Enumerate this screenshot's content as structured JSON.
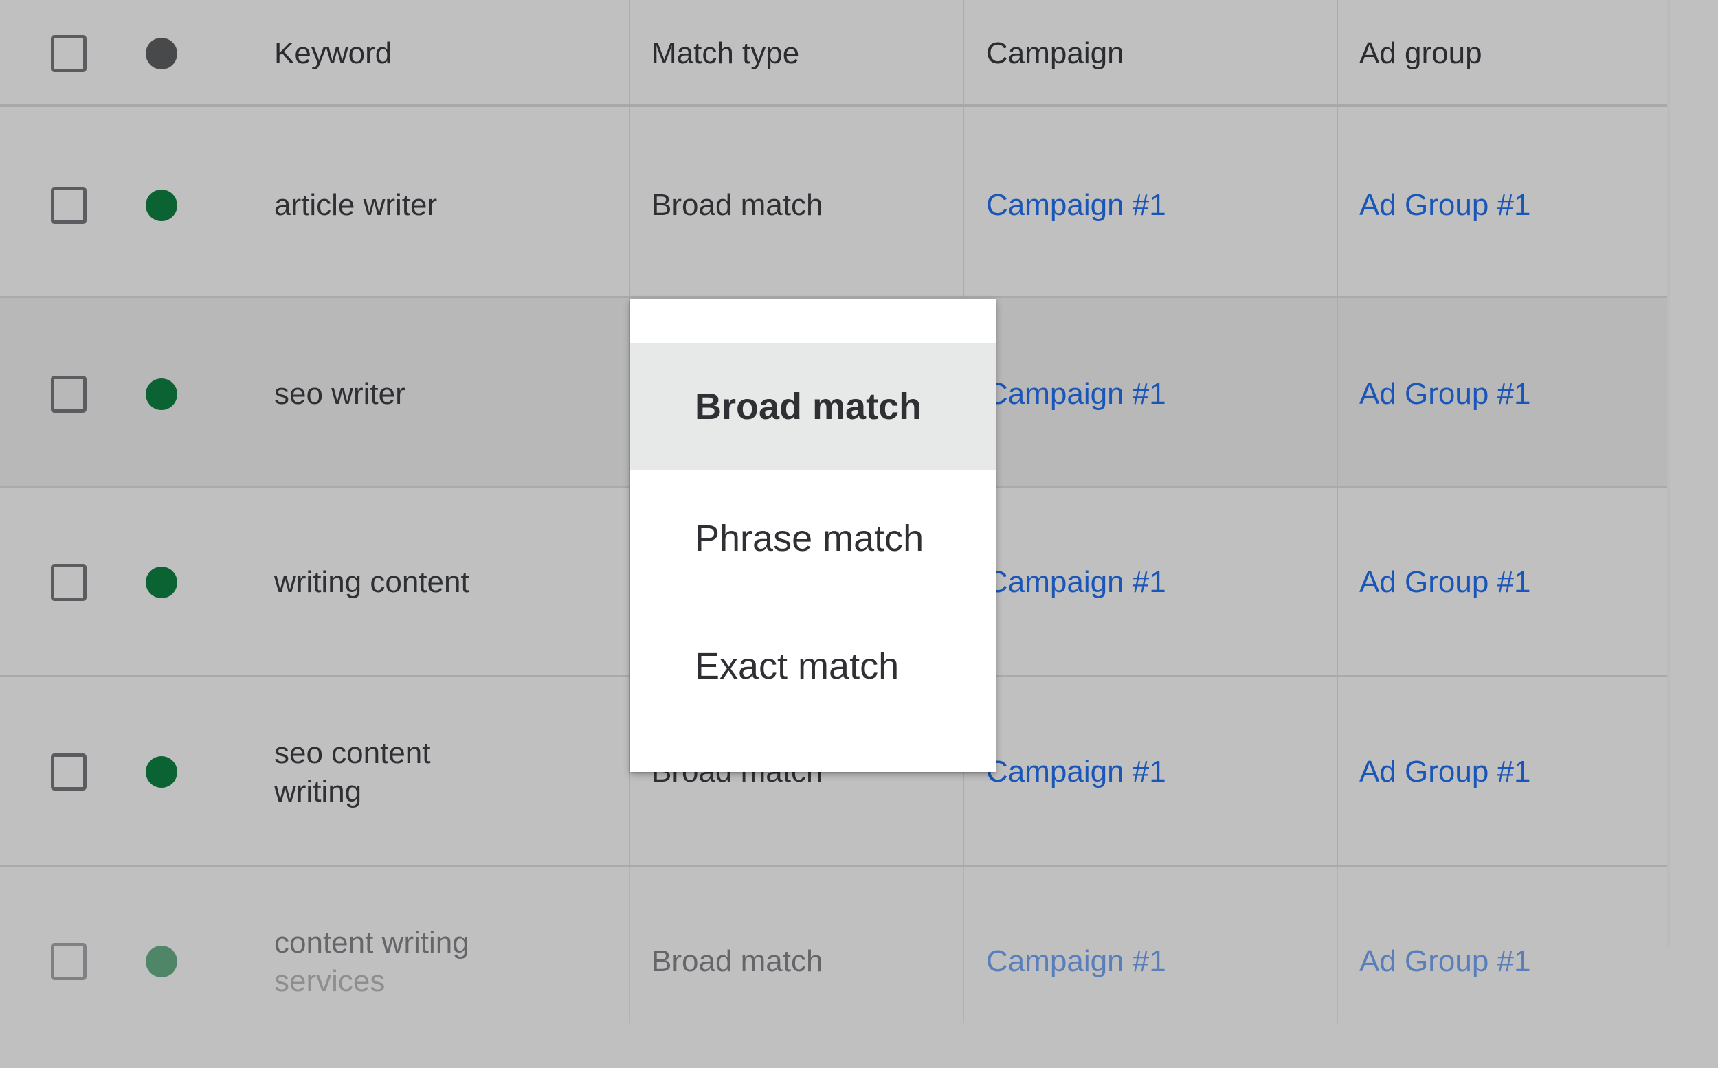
{
  "table": {
    "columns": {
      "select_all": "",
      "status": "",
      "keyword": "Keyword",
      "match_type": "Match type",
      "campaign": "Campaign",
      "ad_group": "Ad group"
    },
    "header_status_color": "#48494b",
    "rows": [
      {
        "keyword_line1": "article writer",
        "keyword_line2": "",
        "match_type": "Broad match",
        "campaign": "Campaign #1",
        "ad_group": "Ad Group #1",
        "status_color": "#0b6333",
        "checked": false
      },
      {
        "keyword_line1": "seo writer",
        "keyword_line2": "",
        "match_type": "Broad match",
        "campaign": "Campaign #1",
        "ad_group": "Ad Group #1",
        "status_color": "#0b6333",
        "checked": false
      },
      {
        "keyword_line1": "writing content",
        "keyword_line2": "",
        "match_type": "Broad match",
        "campaign": "Campaign #1",
        "ad_group": "Ad Group #1",
        "status_color": "#0b6333",
        "checked": false
      },
      {
        "keyword_line1": "seo content",
        "keyword_line2": "writing",
        "match_type": "Broad match",
        "campaign": "Campaign #1",
        "ad_group": "Ad Group #1",
        "status_color": "#0b6333",
        "checked": false
      },
      {
        "keyword_line1": "content writing",
        "keyword_line2": "services",
        "match_type": "Broad match",
        "campaign": "Campaign #1",
        "ad_group": "Ad Group #1",
        "status_color": "#0b6333",
        "checked": false
      }
    ]
  },
  "match_type_dropdown": {
    "selected": "Broad match",
    "options": [
      "Broad match",
      "Phrase match",
      "Exact match"
    ]
  },
  "colors": {
    "link": "#1a56b8",
    "enabled_status": "#0b6333",
    "dropdown_selected_bg": "#e7e8e8"
  }
}
